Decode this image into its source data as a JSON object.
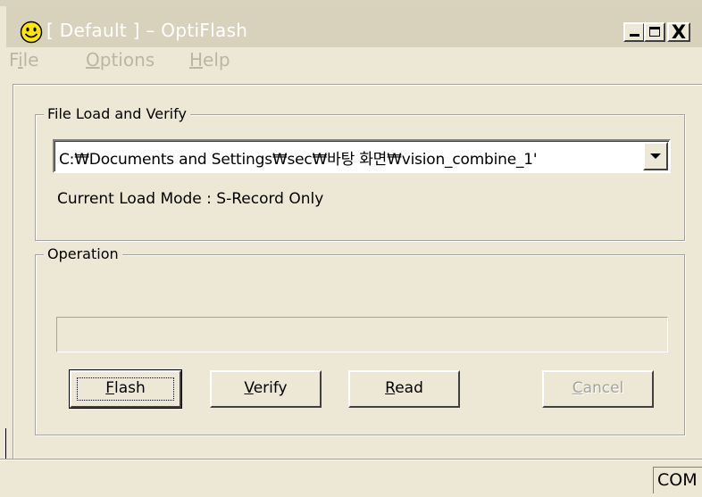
{
  "window": {
    "title": "[ Default ] – OptiFlash",
    "icon": "smiley-icon",
    "controls": {
      "minimize": "minimize-icon",
      "maximize": "maximize-icon",
      "close": "X"
    }
  },
  "menu": {
    "file_prefix": "F",
    "file_mnemonic": "i",
    "file_rest": "le",
    "options_mnemonic": "O",
    "options_rest": "ptions",
    "help_mnemonic": "H",
    "help_rest": "elp"
  },
  "file_group": {
    "label": "File Load and Verify",
    "path_value": "C:₩Documents and Settings₩sec₩바탕 화면₩vision_combine_1'",
    "load_mode": "Current Load Mode : S-Record Only"
  },
  "operation_group": {
    "label": "Operation",
    "progress": 0
  },
  "buttons": {
    "flash_mnemonic": "F",
    "flash_rest": "lash",
    "verify_mnemonic": "V",
    "verify_rest": "erify",
    "read_mnemonic": "R",
    "read_rest": "ead",
    "cancel_mnemonic": "C",
    "cancel_rest": "ancel"
  },
  "status": {
    "port": "COM"
  },
  "colors": {
    "face": "#ece8d5",
    "inactive_title": "#d8d2bc",
    "disabled_text": "#a6a39a"
  }
}
